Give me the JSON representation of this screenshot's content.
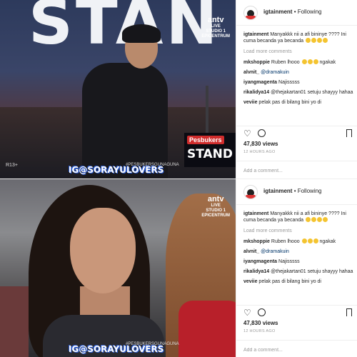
{
  "top_post": {
    "media": {
      "big_title": "STAN",
      "channel_logo": "antv",
      "channel_line1": "LIVE",
      "channel_line2": "STUDIO 1",
      "channel_line3": "EPICENTRUM",
      "badge_small": "Pesbukers",
      "badge_big": "STAND U",
      "rating": "R13+",
      "hashtag": "#PESBUKERSGUNAGUNA",
      "watermark": "IG@SORAYULOVERS"
    },
    "panel": {
      "username": "igtainment",
      "follow_status": "• Following",
      "caption_user": "igtainment",
      "caption_text": "Manyakkk nii a afi bininye ???? Ini cuma becanda ya becanda",
      "load_more": "Load more comments",
      "comments": [
        {
          "user": "mkshoppie",
          "text": "Ruben lhooo",
          "suffix": "ngakak"
        },
        {
          "user": "alvnit_",
          "text": "@dramakuin",
          "suffix": ""
        },
        {
          "user": "iyangmagenta",
          "text": "Najisssss",
          "suffix": ""
        },
        {
          "user": "rikalidya14",
          "text": "@thejakartan01 setuju shayyy hahaa",
          "suffix": ""
        },
        {
          "user": "veviie",
          "text": "pelak pas di bilang bini yo di",
          "suffix": ""
        }
      ],
      "views": "47,830 views",
      "time": "12 HOURS AGO",
      "add_comment_placeholder": "Add a comment..."
    }
  },
  "bottom_post": {
    "media": {
      "channel_logo": "antv",
      "channel_line1": "LIVE",
      "channel_line2": "STUDIO 1",
      "channel_line3": "EPICENTRUM",
      "hashtag": "#PESBUKERSGUNAGUNA",
      "watermark": "IG@SORAYULOVERS"
    },
    "panel": {
      "username": "igtainment",
      "follow_status": "• Following",
      "caption_user": "igtainment",
      "caption_text": "Manyakkk nii a afi bininye ???? Ini cuma becanda ya becanda",
      "load_more": "Load more comments",
      "comments": [
        {
          "user": "mkshoppie",
          "text": "Ruben lhooo",
          "suffix": "ngakak"
        },
        {
          "user": "alvnit_",
          "text": "@dramakuin",
          "suffix": ""
        },
        {
          "user": "iyangmagenta",
          "text": "Najisssss",
          "suffix": ""
        },
        {
          "user": "rikalidya14",
          "text": "@thejakartan01 setuju shayyy hahaa",
          "suffix": ""
        },
        {
          "user": "veviie",
          "text": "pelak pas di bilang bini yo di",
          "suffix": ""
        }
      ],
      "views": "47,830 views",
      "time": "12 HOURS AGO",
      "add_comment_placeholder": "Add a comment..."
    }
  },
  "icons": [
    "heart-icon",
    "comment-icon",
    "bookmark-icon",
    "avatar"
  ],
  "colors": {
    "emoji": "#f4c430",
    "mention": "#003569",
    "muted": "#999999"
  }
}
